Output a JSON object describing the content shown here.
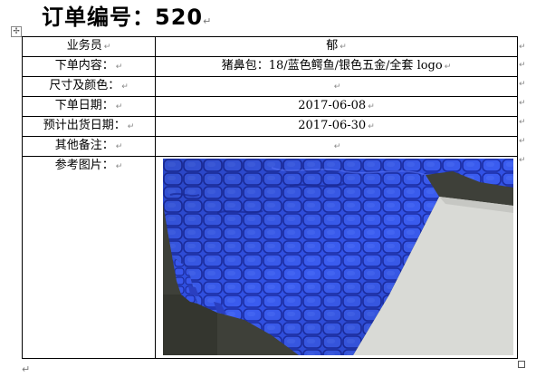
{
  "document": {
    "title": "订单编号：520",
    "paragraph_mark": "↵",
    "cell_mark": "↵",
    "move_handle_glyph": "✢"
  },
  "table": {
    "rows": [
      {
        "label": "业务员",
        "value": "郁"
      },
      {
        "label": "下单内容：",
        "value": "猪鼻包：18/蓝色鳄鱼/银色五金/全套 logo"
      },
      {
        "label": "尺寸及颜色：",
        "value": ""
      },
      {
        "label": "下单日期：",
        "value": "2017-06-08"
      },
      {
        "label": "预计出货日期：",
        "value": "2017-06-30"
      },
      {
        "label": "其他备注：",
        "value": ""
      },
      {
        "label": "参考图片：",
        "value": ""
      }
    ]
  },
  "photo": {
    "subject": "blue crocodile leather",
    "colors": {
      "leather": "#2f4fe0",
      "leather_dark": "#1e2fa8",
      "background": "#3e4039",
      "paper": "#d9dad6"
    }
  }
}
